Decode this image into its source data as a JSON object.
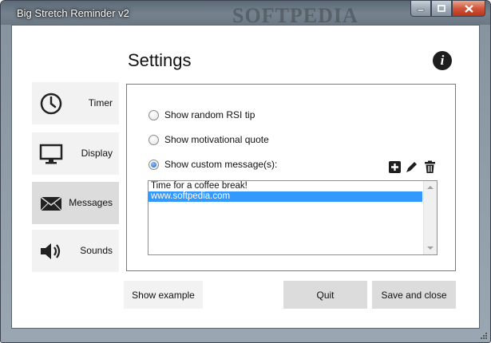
{
  "window": {
    "title": "Big Stretch Reminder v2",
    "watermark": "SOFTPEDIA"
  },
  "header": {
    "title": "Settings",
    "info_icon": "info-icon"
  },
  "sidebar": {
    "items": [
      {
        "label": "Timer",
        "icon": "clock-icon",
        "active": false
      },
      {
        "label": "Display",
        "icon": "monitor-icon",
        "active": false
      },
      {
        "label": "Messages",
        "icon": "envelope-icon",
        "active": true
      },
      {
        "label": "Sounds",
        "icon": "speaker-icon",
        "active": false
      }
    ]
  },
  "messages_panel": {
    "options": [
      {
        "label": "Show random RSI tip",
        "checked": false
      },
      {
        "label": "Show motivational quote",
        "checked": false
      },
      {
        "label": "Show custom message(s):",
        "checked": true
      }
    ],
    "tools": [
      "add-icon",
      "edit-icon",
      "delete-icon"
    ],
    "custom_messages": [
      {
        "text": "Time for a coffee break!",
        "selected": false
      },
      {
        "text": "www.softpedia.com",
        "selected": true
      }
    ]
  },
  "footer": {
    "show_example": "Show example",
    "quit": "Quit",
    "save_and_close": "Save and close"
  },
  "colors": {
    "selection": "#3399ff",
    "nav_bg": "#f2f2f2",
    "nav_active_bg": "#dcdcdc"
  }
}
